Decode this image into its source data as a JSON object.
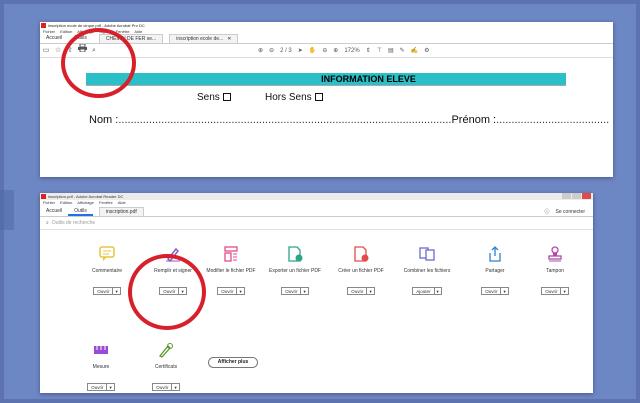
{
  "top": {
    "title": "inscription ecole de cirque.pdf - Adobe Acrobat Pro DC",
    "menu": [
      "Fichier",
      "Edition",
      "Affichage",
      "Signer",
      "Fenêtre",
      "Aide"
    ],
    "tabs": [
      "Accueil",
      "Outils"
    ],
    "doc_tabs": [
      "CHEMIN DE FER se...",
      "inscription ecole de..."
    ],
    "page_indicator": "2 / 3",
    "zoom": "172%",
    "document": {
      "banner": "INFORMATION ELEVE",
      "sens_label": "Sens",
      "hors_sens_label": "Hors Sens",
      "nom_label": "Nom :",
      "prenom_label": "Prénom :"
    }
  },
  "bottom": {
    "title": "inscription.pdf - Adobe Acrobat Reader DC",
    "menu": [
      "Fichier",
      "Edition",
      "Affichage",
      "Fenêtre",
      "Aide"
    ],
    "tabs": [
      "Accueil",
      "Outils"
    ],
    "doc_tab": "inscription.pdf",
    "connect_label": "Se connecter",
    "search_placeholder": "Outils de recherche",
    "tools": [
      {
        "name": "Commentaire",
        "action": "Ouvrir",
        "icon": "comment-icon",
        "color": "#e8c540"
      },
      {
        "name": "Remplir et signer",
        "action": "Ouvrir",
        "icon": "fill-sign-icon",
        "color": "#8b5cc7"
      },
      {
        "name": "Modifier le fichier PDF",
        "action": "Ouvrir",
        "icon": "edit-pdf-icon",
        "color": "#e44a8a"
      },
      {
        "name": "Exporter un fichier PDF",
        "action": "Ouvrir",
        "icon": "export-pdf-icon",
        "color": "#2aa58a"
      },
      {
        "name": "Créer un fichier PDF",
        "action": "Ouvrir",
        "icon": "create-pdf-icon",
        "color": "#e34a4a"
      },
      {
        "name": "Combiner les fichiers",
        "action": "Ajouter",
        "icon": "combine-icon",
        "color": "#6a6ad0"
      },
      {
        "name": "Partager",
        "action": "Ouvrir",
        "icon": "share-icon",
        "color": "#2a7fd4"
      },
      {
        "name": "Tampon",
        "action": "Ouvrir",
        "icon": "stamp-icon",
        "color": "#b04aa8"
      },
      {
        "name": "Mesure",
        "action": "Ouvrir",
        "icon": "measure-icon",
        "color": "#9a4ad4"
      },
      {
        "name": "Certificats",
        "action": "Ouvrir",
        "icon": "certificate-icon",
        "color": "#5a9a2a"
      }
    ],
    "more_label": "Afficher plus"
  },
  "colors": {
    "background": "#6d86c4",
    "banner": "#2bbfc7",
    "highlight_circle": "#d8202a",
    "tab_accent": "#1a73e8"
  }
}
